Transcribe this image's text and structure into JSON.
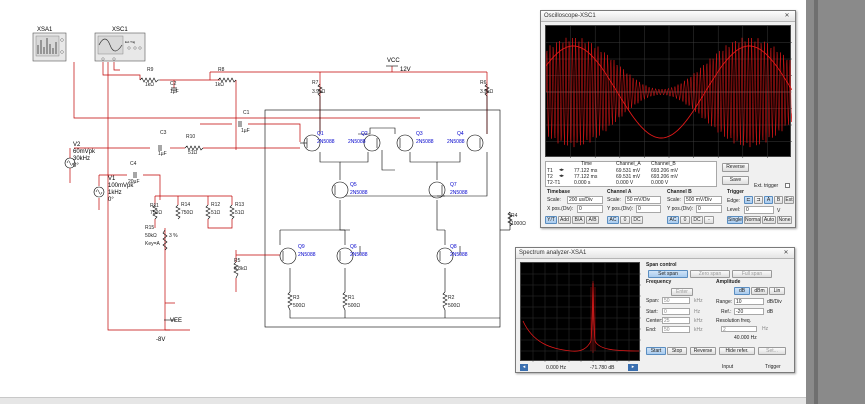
{
  "schematic": {
    "instruments": {
      "xsa1": "XSA1",
      "xsc1": "XSC1"
    },
    "supply": {
      "vcc_name": "VCC",
      "vcc_value": "12V",
      "vee_name": "VEE",
      "vee_value": "-8V"
    },
    "sources": [
      {
        "name": "V2",
        "l1": "60mVpk",
        "l2": "30kHz",
        "l3": "0°"
      },
      {
        "name": "V1",
        "l1": "100mVpk",
        "l2": "1kHz",
        "l3": "0°"
      }
    ],
    "resistors": [
      {
        "name": "R9",
        "value": "1kΩ"
      },
      {
        "name": "R8",
        "value": "1kΩ"
      },
      {
        "name": "R7",
        "value": "3.9kΩ"
      },
      {
        "name": "R6",
        "value": "3.9kΩ"
      },
      {
        "name": "R10",
        "value": "51Ω"
      },
      {
        "name": "R11",
        "value": "750Ω"
      },
      {
        "name": "R14",
        "value": "750Ω"
      },
      {
        "name": "R12",
        "value": "51Ω"
      },
      {
        "name": "R13",
        "value": "51Ω"
      },
      {
        "name": "R4",
        "value": "1000Ω"
      },
      {
        "name": "R5",
        "value": "6.8kΩ"
      },
      {
        "name": "R3",
        "value": "500Ω"
      },
      {
        "name": "R1",
        "value": "500Ω"
      },
      {
        "name": "R2",
        "value": "500Ω"
      }
    ],
    "capacitors": [
      {
        "name": "C2",
        "value": "1µF"
      },
      {
        "name": "C1",
        "value": "1µF"
      },
      {
        "name": "C3",
        "value": "1µF"
      },
      {
        "name": "C4",
        "value": "20µF"
      }
    ],
    "pot": {
      "name": "R15",
      "l1": "50kΩ",
      "l2": "Key=A",
      "pct": "3 %"
    },
    "transistors": [
      {
        "name": "Q1",
        "model": "2N5088"
      },
      {
        "name": "Q2",
        "model": "2N5088"
      },
      {
        "name": "Q3",
        "model": "2N5088"
      },
      {
        "name": "Q4",
        "model": "2N5088"
      },
      {
        "name": "Q5",
        "model": "2N5088"
      },
      {
        "name": "Q7",
        "model": "2N5088"
      },
      {
        "name": "Q9",
        "model": "2N5088"
      },
      {
        "name": "Q6",
        "model": "2N5088"
      },
      {
        "name": "Q8",
        "model": "2N5088"
      }
    ]
  },
  "oscilloscope": {
    "title": "Oscilloscope-XSC1",
    "readout": {
      "headers": [
        "Time",
        "Channel_A",
        "Channel_B"
      ],
      "rows": [
        {
          "label": "T1",
          "time": "77.122 ms",
          "a": "69.531 mV",
          "b": "693.206 mV"
        },
        {
          "label": "T2",
          "time": "77.122 ms",
          "a": "69.531 mV",
          "b": "693.206 mV"
        },
        {
          "label": "T2-T1",
          "time": "0.000 s",
          "a": "0.000 V",
          "b": "0.000 V"
        }
      ]
    },
    "reverse": "Reverse",
    "save": "Save",
    "ext_trigger": "Ext. trigger",
    "timebase": {
      "title": "Timebase",
      "scale_label": "Scale:",
      "scale": "200 us/Div",
      "xpos_label": "X pos.(Div):",
      "xpos": "0",
      "modes": [
        "Y/T",
        "Add",
        "B/A",
        "A/B"
      ]
    },
    "channel_a": {
      "title": "Channel A",
      "scale_label": "Scale:",
      "scale": "50 mV/Div",
      "ypos_label": "Y pos.(Div):",
      "ypos": "0",
      "coupling": [
        "AC",
        "0",
        "DC"
      ]
    },
    "channel_b": {
      "title": "Channel B",
      "scale_label": "Scale:",
      "scale": "500 mV/Div",
      "ypos_label": "Y pos.(Div):",
      "ypos": "0",
      "coupling": [
        "AC",
        "0",
        "DC",
        "-"
      ]
    },
    "trigger": {
      "title": "Trigger",
      "edge_label": "Edge:",
      "edge_buttons": [
        "A",
        "B",
        "Ext"
      ],
      "level_label": "Level:",
      "level": "0",
      "level_unit": "V",
      "modes": [
        "Single",
        "Normal",
        "Auto",
        "None"
      ]
    }
  },
  "spectrum": {
    "title": "Spectrum analyzer-XSA1",
    "span_control": {
      "title": "Span control",
      "buttons": [
        "Set span",
        "Zero span",
        "Full span"
      ]
    },
    "frequency": {
      "title": "Frequency",
      "enter": "Enter",
      "rows": [
        {
          "label": "Span:",
          "value": "50",
          "unit": "kHz"
        },
        {
          "label": "Start:",
          "value": "0",
          "unit": "Hz"
        },
        {
          "label": "Center:",
          "value": "25",
          "unit": "kHz"
        },
        {
          "label": "End:",
          "value": "50",
          "unit": "kHz"
        }
      ]
    },
    "amplitude": {
      "title": "Amplitude",
      "buttons": [
        "dB",
        "dBm",
        "Lin"
      ],
      "range_label": "Range:",
      "range": "10",
      "range_unit": "dB/Div",
      "ref_label": "Ref.:",
      "ref": "-20",
      "ref_unit": "dB"
    },
    "resolution": {
      "title": "Resolution freq.",
      "value": "40.000 Hz",
      "unit": "Hz",
      "small": "2"
    },
    "buttons": [
      "Start",
      "Stop",
      "Reverse",
      "Hide refer.",
      "Set..."
    ],
    "readout": {
      "freq": "0.000 Hz",
      "amp": "-71.780 dB"
    },
    "input": "Input",
    "trigger": "Trigger"
  }
}
